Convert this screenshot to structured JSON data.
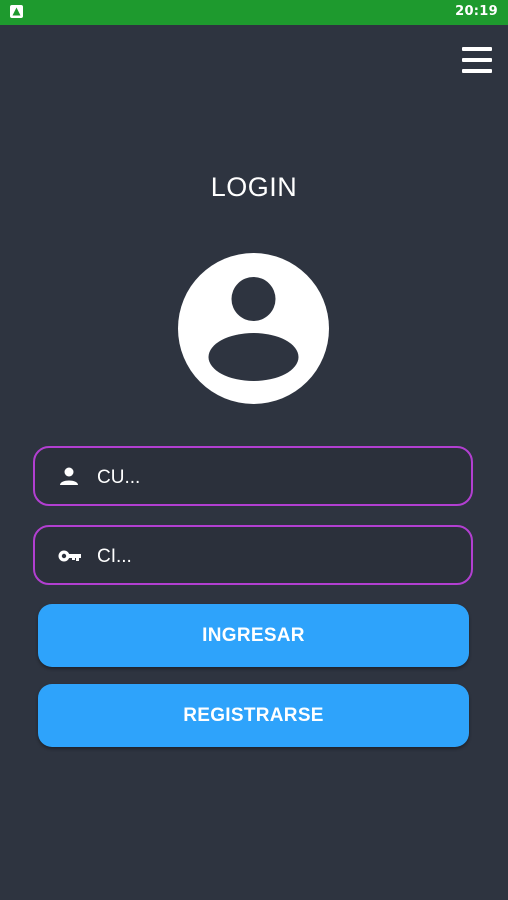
{
  "status_bar": {
    "time": "20:19",
    "app_icon": "app-notification-icon",
    "color": "#1e9a2e"
  },
  "header": {
    "menu_icon": "hamburger-menu-icon",
    "title": "LOGIN"
  },
  "avatar": {
    "icon": "user-avatar-icon"
  },
  "form": {
    "user_field": {
      "icon": "person-icon",
      "value": "CU..."
    },
    "password_field": {
      "icon": "key-icon",
      "value": "CI..."
    },
    "border_color": "#b23fd1"
  },
  "buttons": {
    "login_label": "INGRESAR",
    "register_label": "REGISTRARSE",
    "color": "#2ea3fb"
  },
  "theme": {
    "background": "#2e3440"
  }
}
